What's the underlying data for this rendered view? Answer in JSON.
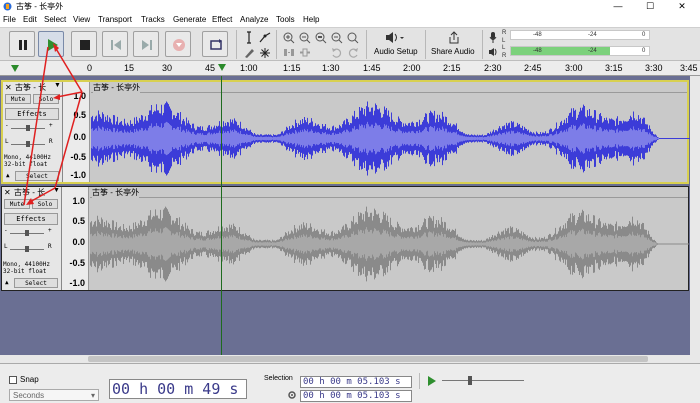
{
  "window": {
    "title": "古筝 - 长亭外",
    "minimize": "—",
    "maximize": "☐",
    "close": "✕"
  },
  "menu": [
    "File",
    "Edit",
    "Select",
    "View",
    "Transport",
    "Tracks",
    "Generate",
    "Effect",
    "Analyze",
    "Tools",
    "Help"
  ],
  "toolbar": {
    "audio_setup": "Audio Setup",
    "share_audio": "Share Audio",
    "meter_rec_labels": [
      "-48",
      "-24",
      "0"
    ],
    "meter_play_labels": [
      "-48",
      "-24",
      "0"
    ],
    "meter_rec_channels": [
      "R",
      "L"
    ],
    "meter_play_channels": [
      "L",
      "R"
    ],
    "playback_level": 0.72
  },
  "timeline": {
    "ticks": [
      "0",
      "15",
      "30",
      "45",
      "1:00",
      "1:15",
      "1:30",
      "1:45",
      "2:00",
      "2:15",
      "2:30",
      "2:45",
      "3:00",
      "3:15",
      "3:30",
      "3:45"
    ]
  },
  "tracks": [
    {
      "close": "✕",
      "name": "古筝 - 长",
      "menu_arrow": "▼",
      "mute": "Mute",
      "solo": "Solo",
      "effects": "Effects",
      "gain_min": "-",
      "gain_max": "+",
      "pan_left": "L",
      "pan_right": "R",
      "info1": "Mono, 44100Hz",
      "info2": "32-bit float",
      "collapse": "▲",
      "select": "Select",
      "clip_name": "古筝 - 长亭外",
      "scale": [
        "1.0",
        "0.5",
        "0.0",
        "-0.5",
        "-1.0"
      ],
      "selected": true,
      "wave_color": "#3c3cd8",
      "wave_light": "#7d7de8"
    },
    {
      "close": "✕",
      "name": "古筝 - 长",
      "menu_arrow": "▼",
      "mute": "Mute",
      "solo": "Solo",
      "effects": "Effects",
      "gain_min": "-",
      "gain_max": "+",
      "pan_left": "L",
      "pan_right": "R",
      "info1": "Mono, 44100Hz",
      "info2": "32-bit float",
      "collapse": "▲",
      "select": "Select",
      "clip_name": "古筝 - 长亭外",
      "scale": [
        "1.0",
        "0.5",
        "0.0",
        "-0.5",
        "-1.0"
      ],
      "selected": false,
      "wave_color": "#8a8a8a",
      "wave_light": "#a8a8a8"
    }
  ],
  "selection_toolbar": {
    "snap": "Snap",
    "snap_mode": "Seconds",
    "position": "00 h 00 m 49 s",
    "selection_label": "Selection",
    "sel_start": "00 h 00 m 05.103 s",
    "sel_end": "00 h 00 m 05.103 s"
  },
  "colors": {
    "track_bg": "#c9c9c9",
    "area_bg": "#6a6f93",
    "annotation": "#e02020"
  }
}
